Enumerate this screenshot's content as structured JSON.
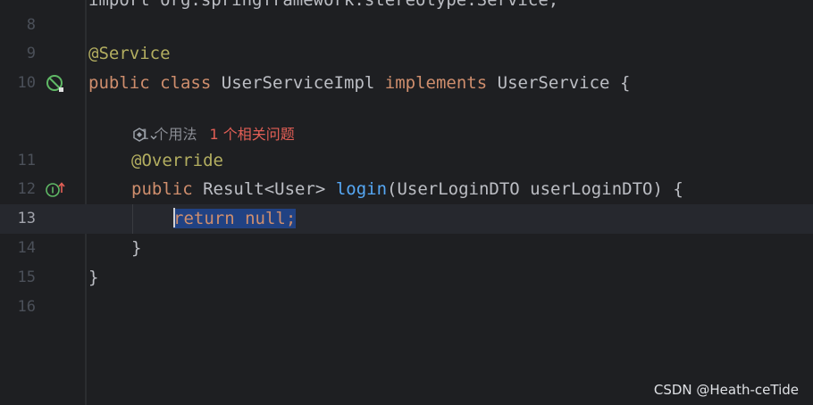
{
  "editor": {
    "lines": [
      {
        "num": "8"
      },
      {
        "num": "9",
        "ann": "@Service"
      },
      {
        "num": "10",
        "kw1": "public",
        "kw2": "class",
        "name": "UserServiceImpl",
        "kw3": "implements",
        "iface": "UserService",
        "brace": "{"
      },
      {
        "num": "11",
        "ann": "@Override"
      },
      {
        "num": "12",
        "kw": "public",
        "type": "Result<User>",
        "fn": "login",
        "params": "(UserLoginDTO userLoginDTO) {"
      },
      {
        "num": "13",
        "kw": "return",
        "val": "null;"
      },
      {
        "num": "14",
        "text": "}"
      },
      {
        "num": "15",
        "text": "}"
      },
      {
        "num": "16"
      }
    ],
    "top_partial": "import org.springframework.stereotype.Service;",
    "inlay_hint": {
      "usages": "1 个用法",
      "problems": "1 个相关问题"
    }
  },
  "gutter_icons": {
    "line10": "no-entry-icon",
    "line12": "implements-method-icon"
  },
  "ai_action_icon": "ai-assistant-icon",
  "watermark": "CSDN @Heath-ceTide",
  "colors": {
    "background": "#1e1f22",
    "keyword": "#cf8e6d",
    "annotation": "#b3ae60",
    "function": "#56a8f5",
    "selection": "#214283",
    "problem": "#e35f56",
    "gutter_icon": "#5fb865"
  }
}
